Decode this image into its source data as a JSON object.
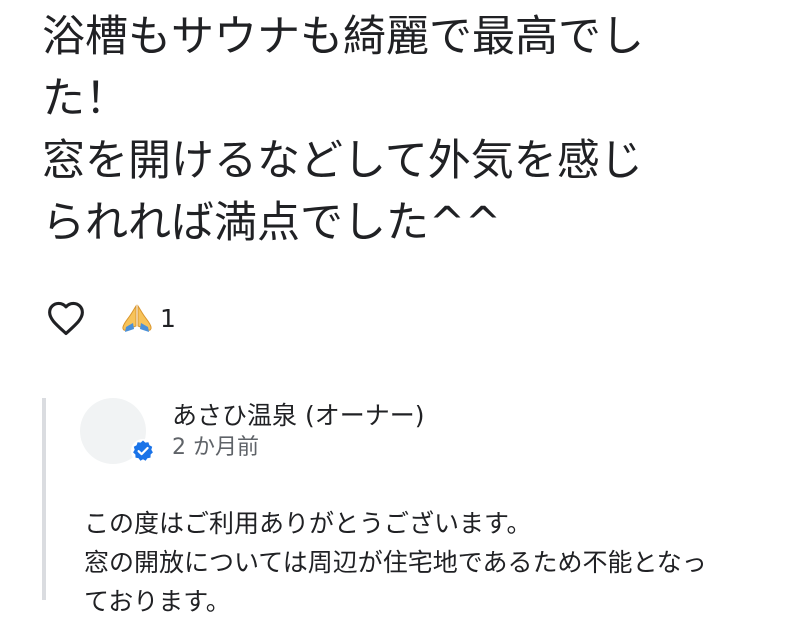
{
  "review": {
    "text_lines": [
      "浴槽もサウナも綺麗で最高でし",
      "た！",
      "窓を開けるなどして外気を感じ",
      "られれば満点でした^^"
    ]
  },
  "reactions": {
    "like_icon": "heart-outline-icon",
    "reaction_emoji": "🙏",
    "reaction_count": "1"
  },
  "owner_reply": {
    "name": "あさひ温泉 (オーナー)",
    "date": "2 か月前",
    "verified_icon": "verified-check-icon",
    "text_lines": [
      "この度はご利用ありがとうございます。",
      "窓の開放については周辺が住宅地であるため不能となっ",
      "ております。"
    ]
  },
  "colors": {
    "text_primary": "#202124",
    "text_secondary": "#5f6368",
    "verified_blue": "#1a73e8",
    "reply_border": "#dadce0",
    "avatar_bg": "#f1f3f4"
  }
}
